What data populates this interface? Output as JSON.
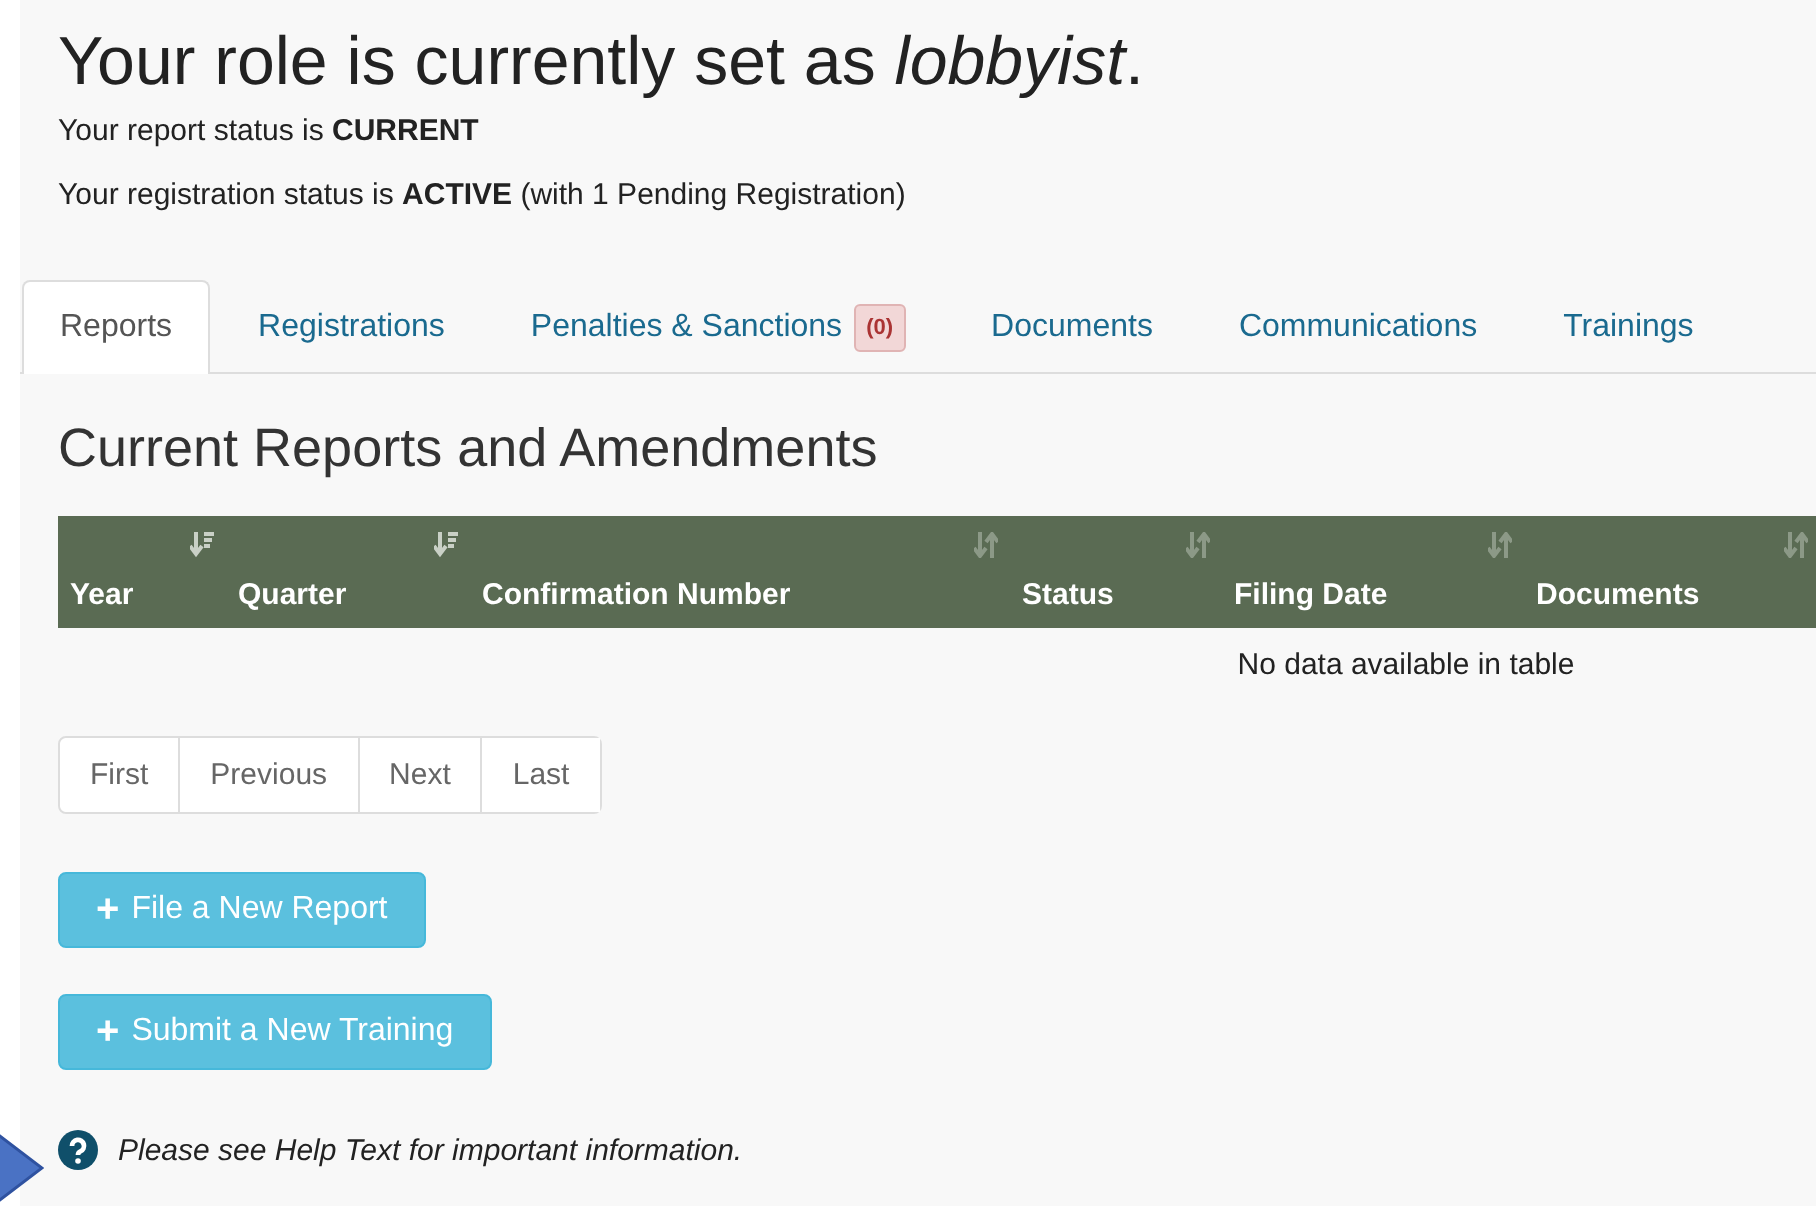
{
  "heading": {
    "text": "Your role is currently set as *lobbyist*."
  },
  "status_lines": [
    "Your report status is **CURRENT**",
    "Your registration status is **ACTIVE** (with 1 Pending Registration)"
  ],
  "tabs": [
    {
      "label": "Reports",
      "selected": true
    },
    {
      "label": "Registrations",
      "selected": false
    },
    {
      "label": "Penalties & Sanctions",
      "selected": false,
      "badge": "(0)"
    },
    {
      "label": "Documents",
      "selected": false
    },
    {
      "label": "Communications",
      "selected": false
    },
    {
      "label": "Trainings",
      "selected": false
    }
  ],
  "section_title": "Current Reports and Amendments",
  "table": {
    "columns": [
      {
        "label": "Year",
        "sorted": true
      },
      {
        "label": "Quarter",
        "sorted": true
      },
      {
        "label": "Confirmation Number",
        "sorted": false
      },
      {
        "label": "Status",
        "sorted": false
      },
      {
        "label": "Filing Date",
        "sorted": false
      },
      {
        "label": "Documents",
        "sorted": false
      }
    ],
    "empty_message": "No data available in table"
  },
  "pagination": [
    "First",
    "Previous",
    "Next",
    "Last"
  ],
  "actions": [
    {
      "icon": "+",
      "label": "File a New Report"
    },
    {
      "icon": "+",
      "label": "Submit a New Training"
    }
  ],
  "help_text": "Please see Help Text for important information."
}
